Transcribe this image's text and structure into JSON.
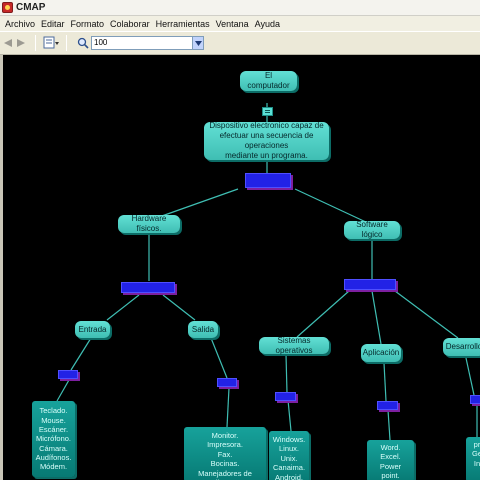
{
  "window": {
    "title": "CMAP"
  },
  "menu": [
    "Archivo",
    "Editar",
    "Formato",
    "Colaborar",
    "Herramientas",
    "Ventana",
    "Ayuda"
  ],
  "toolbar": {
    "zoom_value": "100"
  },
  "map": {
    "root": "El computador",
    "definition": "Dispositivo electronico capaz  de\nefectuar una secuencia de operaciones\nmediante un programa.",
    "hardware": "Hardware físicos.",
    "software": "Software lógico",
    "entrada": "Entrada",
    "salida": "Salida",
    "sistemas": "Sistemas operativos",
    "aplicacion": "Aplicación",
    "desarrollo": "Desarrollo",
    "entrada_items": "Teclado.\nMouse.\nEscáner.\nMicrófono.\nCámara.\nAudífonos.\nMódem.",
    "salida_items": "Monitor.\nImpresora.\nFax.\nBocinas.\nManejadores de discos.",
    "sistemas_items": "Windows.\nLinux.\nUnix.\nCanaima.\nAndroid.",
    "aplicacion_items": "Word.\nExcel.\nPower point.\nPhotoshop.",
    "desarrollo_items": "pr\nGe\nIn"
  }
}
